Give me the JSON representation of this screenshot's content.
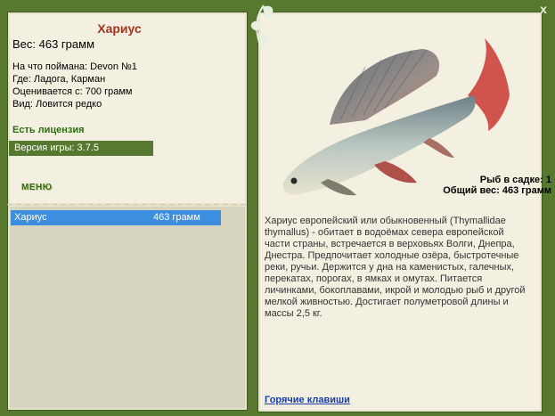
{
  "fish": {
    "name": "Хариус",
    "weight_line": "Вес: 463 грамм",
    "caught_on": "На что поймана: Devon №1",
    "location": "Где: Ладога, Карман",
    "value": "Оценивается с: 700 грамм",
    "rarity": "Вид: Ловится редко",
    "description": "Хариус европейский или обыкновенный (Thymallidae thymallus) - обитает в водоёмах севера европейской части страны, встречается в верховьях Волги, Днепра, Днестра. Предпочитает холодные озёра, быстротечные реки, ручьи. Держится у дна на каменистых, галечных, перекатах, порогах, в ямках и омутах. Питается личинками, бокоплавами, икрой и молодью рыб и другой мелкой живностью. Достигает полуметровой длины и массы 2,5 кг."
  },
  "license": "Есть лицензия",
  "version": "Версия игры: 3.7.5",
  "menu_label": "МЕНЮ",
  "totals": {
    "count_line": "Рыб в садке: 1",
    "weight_line": "Общий вес: 463 грамм"
  },
  "catch_list": [
    {
      "name": "Хариус",
      "weight": "463 грамм"
    }
  ],
  "hotkeys_label": "Горячие клавиши",
  "close_label": "x",
  "colors": {
    "frame": "#56782f",
    "panel": "#f3f0e1",
    "title": "#a0361d",
    "selection": "#3e8ee0"
  },
  "icons": [
    "close-icon",
    "leaf-ornament-icon",
    "grayling-image"
  ]
}
